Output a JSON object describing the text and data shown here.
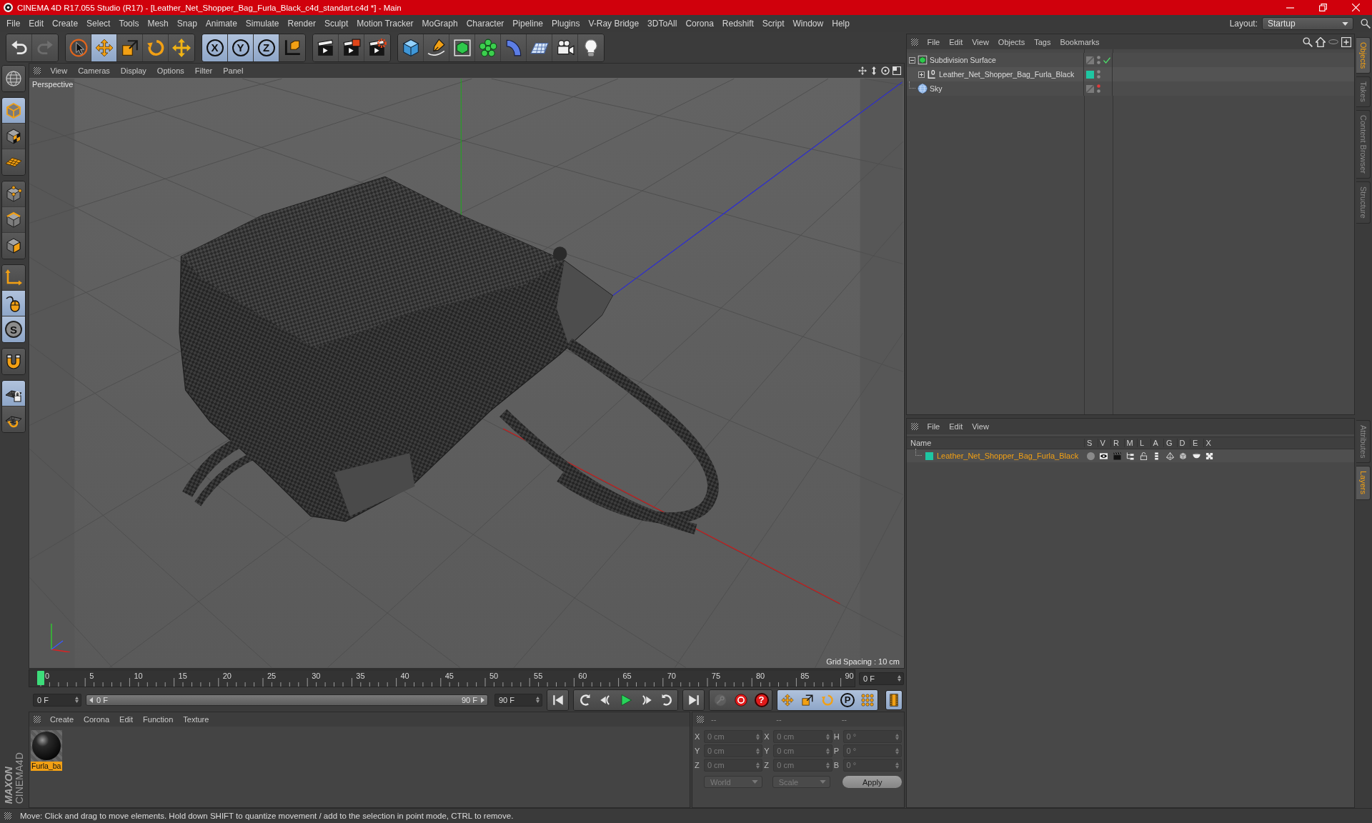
{
  "window": {
    "title": "CINEMA 4D R17.055 Studio (R17) - [Leather_Net_Shopper_Bag_Furla_Black_c4d_standart.c4d *] - Main"
  },
  "menu_bar": {
    "items": [
      "File",
      "Edit",
      "Create",
      "Select",
      "Tools",
      "Mesh",
      "Snap",
      "Animate",
      "Simulate",
      "Render",
      "Sculpt",
      "Motion Tracker",
      "MoGraph",
      "Character",
      "Pipeline",
      "Plugins",
      "V-Ray Bridge",
      "3DToAll",
      "Corona",
      "Redshift",
      "Script",
      "Window",
      "Help"
    ],
    "layout_label": "Layout:",
    "layout_value": "Startup"
  },
  "toolbar": {
    "groups": [
      [
        {
          "kind": "undo",
          "disabled": false
        },
        {
          "kind": "redo",
          "disabled": true
        }
      ],
      [
        {
          "kind": "select",
          "selected": false
        },
        {
          "kind": "move",
          "selected": true
        },
        {
          "kind": "scale",
          "selected": false
        },
        {
          "kind": "rotate",
          "selected": false
        },
        {
          "kind": "transform",
          "selected": false
        }
      ],
      [
        {
          "kind": "axis",
          "label": "X",
          "selected": true
        },
        {
          "kind": "axis",
          "label": "Y",
          "selected": true
        },
        {
          "kind": "axis",
          "label": "Z",
          "selected": true
        },
        {
          "kind": "coords",
          "selected": false
        }
      ],
      [
        {
          "kind": "render-view"
        },
        {
          "kind": "render-viewer"
        },
        {
          "kind": "render-settings"
        }
      ],
      [
        {
          "kind": "cube"
        },
        {
          "kind": "pen"
        },
        {
          "kind": "subdivision"
        },
        {
          "kind": "cloner"
        },
        {
          "kind": "deformer"
        },
        {
          "kind": "floor"
        },
        {
          "kind": "camera"
        },
        {
          "kind": "light"
        }
      ]
    ]
  },
  "left_tools": {
    "groups": [
      [
        {
          "kind": "make-editable",
          "selected": false
        }
      ],
      [
        {
          "kind": "model",
          "selected": true
        },
        {
          "kind": "texture",
          "selected": false
        },
        {
          "kind": "workplane",
          "selected": false
        }
      ],
      [
        {
          "kind": "points",
          "selected": false
        },
        {
          "kind": "edges",
          "selected": false
        },
        {
          "kind": "polygons",
          "selected": false
        }
      ],
      [
        {
          "kind": "axis-mode",
          "selected": false
        },
        {
          "kind": "tweak",
          "selected": true
        },
        {
          "kind": "snap",
          "label": "S",
          "selected": true
        }
      ],
      [
        {
          "kind": "magnet",
          "selected": false
        }
      ],
      [
        {
          "kind": "grid-lock",
          "selected": true
        },
        {
          "kind": "grid-rotate",
          "selected": false
        }
      ]
    ]
  },
  "viewport": {
    "menu": [
      "View",
      "Cameras",
      "Display",
      "Options",
      "Filter",
      "Panel"
    ],
    "camera": "Perspective",
    "grid_spacing": "Grid Spacing : 10 cm"
  },
  "timeline": {
    "ticks": [
      "0",
      "5",
      "10",
      "15",
      "20",
      "25",
      "30",
      "35",
      "40",
      "45",
      "50",
      "55",
      "60",
      "65",
      "70",
      "75",
      "80",
      "85",
      "90"
    ],
    "playhead": {
      "level": 0
    },
    "current_frame": "0 F"
  },
  "playback": {
    "start": "0 F",
    "range_start": "0 F",
    "range_end": "90 F",
    "range": {
      "level": 1
    },
    "end": "90 F",
    "transport": [
      [
        {
          "kind": "first-frame"
        }
      ],
      [
        {
          "kind": "prev-key"
        },
        {
          "kind": "prev-frame"
        },
        {
          "kind": "play"
        },
        {
          "kind": "next-frame"
        },
        {
          "kind": "next-key"
        }
      ],
      [
        {
          "kind": "last-frame"
        }
      ]
    ],
    "key_tools": [
      {
        "kind": "key",
        "disabled": true
      },
      {
        "kind": "record",
        "disabled": false
      },
      {
        "kind": "autokey",
        "label": "?",
        "disabled": false
      }
    ],
    "key_filters": [
      {
        "kind": "move",
        "selected": true
      },
      {
        "kind": "scale",
        "selected": true
      },
      {
        "kind": "rotate",
        "selected": true
      },
      {
        "kind": "param",
        "label": "P",
        "selected": true
      },
      {
        "kind": "dots",
        "selected": true
      }
    ],
    "timeline_button": {
      "selected": true
    }
  },
  "materials": {
    "menu": [
      "Create",
      "Corona",
      "Edit",
      "Function",
      "Texture"
    ],
    "items": [
      {
        "name": "Furla_ba",
        "selected": true
      }
    ]
  },
  "coordinates": {
    "headers": [
      "--",
      "--",
      "--"
    ],
    "disabled": true,
    "rows": [
      {
        "axis": "X",
        "position": "0 cm",
        "size_axis": "X",
        "size": "0 cm",
        "rotation_axis": "H",
        "rotation": "0 °"
      },
      {
        "axis": "Y",
        "position": "0 cm",
        "size_axis": "Y",
        "size": "0 cm",
        "rotation_axis": "P",
        "rotation": "0 °"
      },
      {
        "axis": "Z",
        "position": "0 cm",
        "size_axis": "Z",
        "size": "0 cm",
        "rotation_axis": "B",
        "rotation": "0 °"
      }
    ],
    "mode": "World",
    "size_mode": "Scale",
    "apply": "Apply"
  },
  "objects": {
    "menu": [
      "File",
      "Edit",
      "View",
      "Objects",
      "Tags",
      "Bookmarks"
    ],
    "tree": [
      {
        "name": "Subdivision Surface",
        "kind": "subdivision",
        "expanded": true,
        "selected": false,
        "hidden_in_editor": false,
        "enabled": true,
        "children": [
          {
            "name": "Leather_Net_Shopper_Bag_Furla_Black",
            "kind": "null",
            "expanded": false,
            "selected": false,
            "color": "#1ec6a2",
            "hidden_in_editor": false
          }
        ]
      },
      {
        "name": "Sky",
        "kind": "sky",
        "selected": false,
        "hidden_in_editor": true
      }
    ]
  },
  "layers": {
    "menu": [
      "File",
      "Edit",
      "View"
    ],
    "columns": [
      "Name",
      "S",
      "V",
      "R",
      "M",
      "L",
      "A",
      "G",
      "D",
      "E",
      "X"
    ],
    "rows": [
      {
        "name": "Leather_Net_Shopper_Bag_Furla_Black",
        "color": "#1ec6a2",
        "selected": true
      }
    ]
  },
  "side_tabs": {
    "top": [
      {
        "label": "Objects",
        "selected": true
      },
      {
        "label": "Takes",
        "selected": false
      },
      {
        "label": "Content Browser",
        "selected": false
      },
      {
        "label": "Structure",
        "selected": false
      }
    ],
    "bottom": [
      {
        "label": "Attributes",
        "selected": false
      },
      {
        "label": "Layers",
        "selected": true
      }
    ]
  },
  "logo": {
    "brand": "MAXON",
    "product": "CINEMA4D"
  },
  "status_bar": {
    "text": "Move: Click and drag to move elements. Hold down SHIFT to quantize movement / add to the selection in point mode, CTRL to remove."
  }
}
